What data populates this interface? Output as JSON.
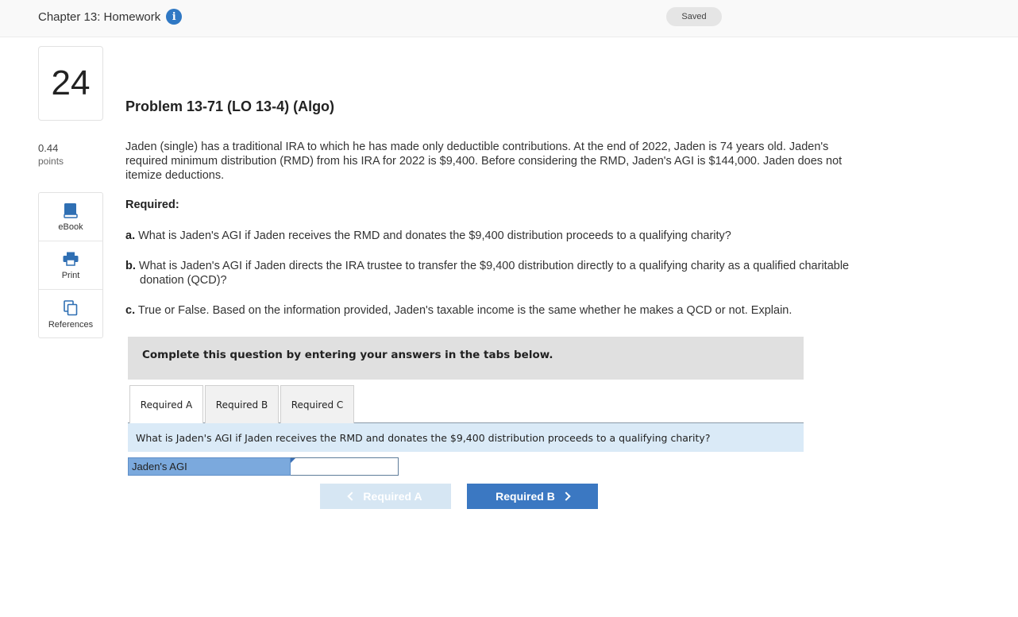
{
  "header": {
    "chapter_title": "Chapter 13: Homework",
    "saved_label": "Saved"
  },
  "question": {
    "number": "24",
    "points_value": "0.44",
    "points_label": "points"
  },
  "tools": {
    "ebook": "eBook",
    "print": "Print",
    "references": "References"
  },
  "problem": {
    "title": "Problem 13-71 (LO 13-4) (Algo)",
    "intro": "Jaden (single) has a traditional IRA to which he has made only deductible contributions. At the end of 2022, Jaden is 74 years old. Jaden's required minimum distribution (RMD) from his IRA for 2022 is $9,400. Before considering the RMD, Jaden's AGI is $144,000. Jaden does not itemize deductions.",
    "required_heading": "Required:",
    "items": [
      {
        "letter": "a.",
        "text": "What is Jaden's AGI if Jaden receives the RMD and donates the $9,400 distribution proceeds to a qualifying charity?"
      },
      {
        "letter": "b.",
        "text": "What is Jaden's AGI if Jaden directs the IRA trustee to transfer the $9,400 distribution directly to a qualifying charity as a qualified charitable donation (QCD)?"
      },
      {
        "letter": "c.",
        "text": "True or False. Based on the information provided, Jaden's taxable income is the same whether he makes a QCD or not. Explain."
      }
    ]
  },
  "answer_area": {
    "instruction": "Complete this question by entering your answers in the tabs below.",
    "tabs": [
      "Required A",
      "Required B",
      "Required C"
    ],
    "active_tab": "Required A",
    "question_text": "What is Jaden's AGI if Jaden receives the RMD and donates the $9,400 distribution proceeds to a qualifying charity?",
    "field_label": "Jaden's AGI",
    "field_value": "",
    "prev_button": "Required A",
    "next_button": "Required B"
  },
  "colors": {
    "accent": "#3b78c2",
    "info_icon": "#2f78c4",
    "question_bar": "#daeaf7",
    "field_label_bg": "#7ba9dd"
  }
}
